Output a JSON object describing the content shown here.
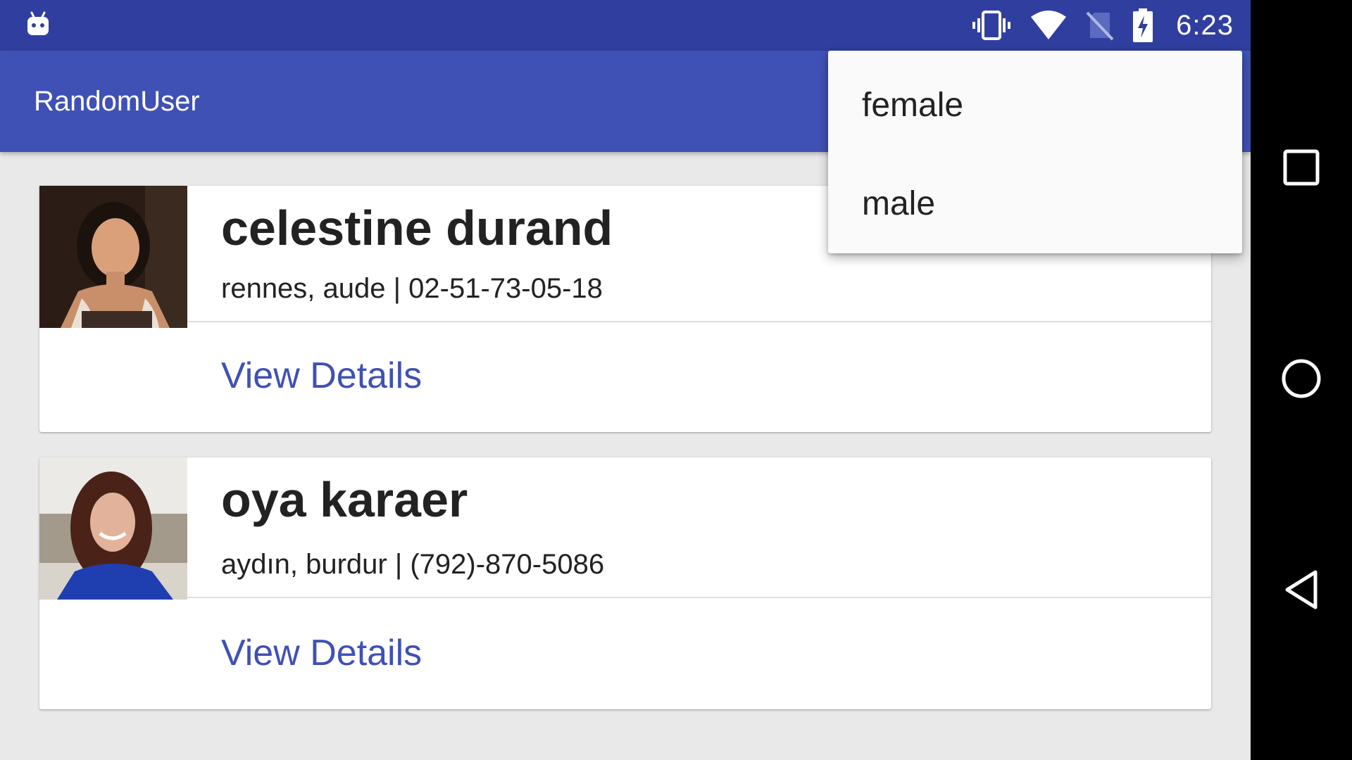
{
  "status_bar": {
    "time": "6:23",
    "icons": [
      "android-debug-icon",
      "vibrate-icon",
      "wifi-icon",
      "no-sim-icon",
      "battery-charging-icon"
    ]
  },
  "app_bar": {
    "title": "RandomUser"
  },
  "users": [
    {
      "name": "celestine durand",
      "subtitle": "rennes, aude | 02-51-73-05-18",
      "action_label": "View Details"
    },
    {
      "name": "oya karaer",
      "subtitle": "aydın, burdur | (792)-870-5086",
      "action_label": "View Details"
    }
  ],
  "overflow_menu": {
    "items": [
      {
        "label": "female"
      },
      {
        "label": "male"
      }
    ]
  },
  "nav_bar": {
    "buttons": [
      "recents-icon",
      "home-icon",
      "back-icon"
    ]
  },
  "colors": {
    "status_bar": "#303f9f",
    "app_bar": "#3f51b5",
    "accent_link": "#3f51b5",
    "background": "#e9e9e9"
  }
}
